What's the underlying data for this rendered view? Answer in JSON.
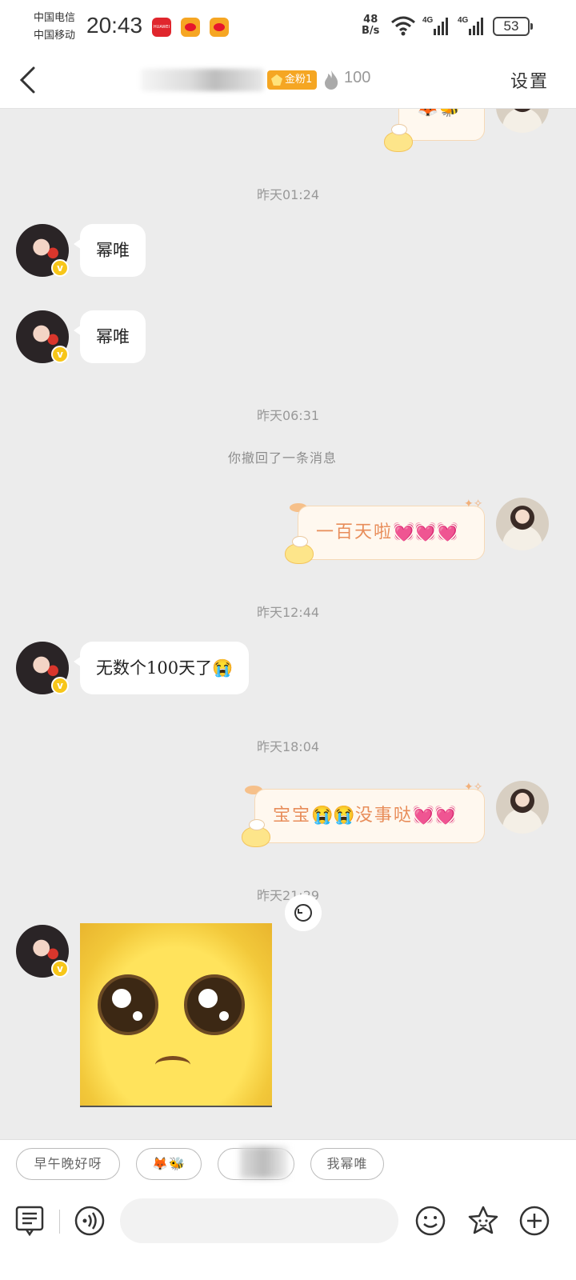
{
  "status_bar": {
    "carrier1": "中国电信",
    "carrier2": "中国移动",
    "time": "20:43",
    "net_speed_value": "48",
    "net_speed_unit": "B/s",
    "sim1_type": "4G",
    "sim2_type": "4G",
    "battery": "53"
  },
  "header": {
    "fan_badge": "金粉1",
    "fire_count": "100",
    "settings_label": "设置"
  },
  "chat": {
    "messages": [
      {
        "timestamp": "昨天01:24"
      },
      {
        "side": "left",
        "text": "幂唯"
      },
      {
        "side": "left",
        "text": "幂唯"
      },
      {
        "timestamp": "昨天06:31"
      },
      {
        "notice": "你撤回了一条消息"
      },
      {
        "side": "right",
        "text": "一百天啦",
        "emoji": "💓💓💓"
      },
      {
        "timestamp": "昨天12:44"
      },
      {
        "side": "left",
        "text": "无数个100天了😭"
      },
      {
        "timestamp": "昨天18:04"
      },
      {
        "side": "right",
        "text_a": "宝宝",
        "emoji_a": "😭😭",
        "text_b": "没事哒",
        "emoji_b": "💓💓"
      },
      {
        "timestamp": "昨天21:29"
      },
      {
        "side": "left",
        "sticker": "pleading-face-sticker"
      }
    ],
    "top_bubble_emoji": "🦊🐝"
  },
  "quick_replies": [
    "早午晚好呀",
    "🦊🐝",
    "",
    "我幂唯"
  ],
  "input": {
    "placeholder": ""
  },
  "colors": {
    "accent_badge": "#f5a623",
    "bubble_right_text": "#e88d5a",
    "background": "#ececec",
    "verified": "#f7c619"
  },
  "icons": [
    "back-icon",
    "flame-icon",
    "wifi-icon",
    "signal-icon",
    "battery-icon",
    "recall-icon",
    "text-mode-icon",
    "voice-icon",
    "emoji-icon",
    "sticker-icon",
    "plus-icon"
  ]
}
